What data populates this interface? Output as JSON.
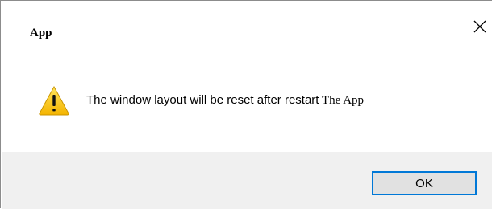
{
  "window": {
    "title": "App",
    "close_icon": "close-icon"
  },
  "message": {
    "icon": "warning-icon",
    "text_main": "The window layout will be reset after restart",
    "text_app": " The App"
  },
  "buttons": {
    "ok_label": "OK"
  },
  "colors": {
    "focus_border": "#0078d7",
    "footer_bg": "#f0f0f0",
    "warning_yellow": "#fcd116"
  }
}
